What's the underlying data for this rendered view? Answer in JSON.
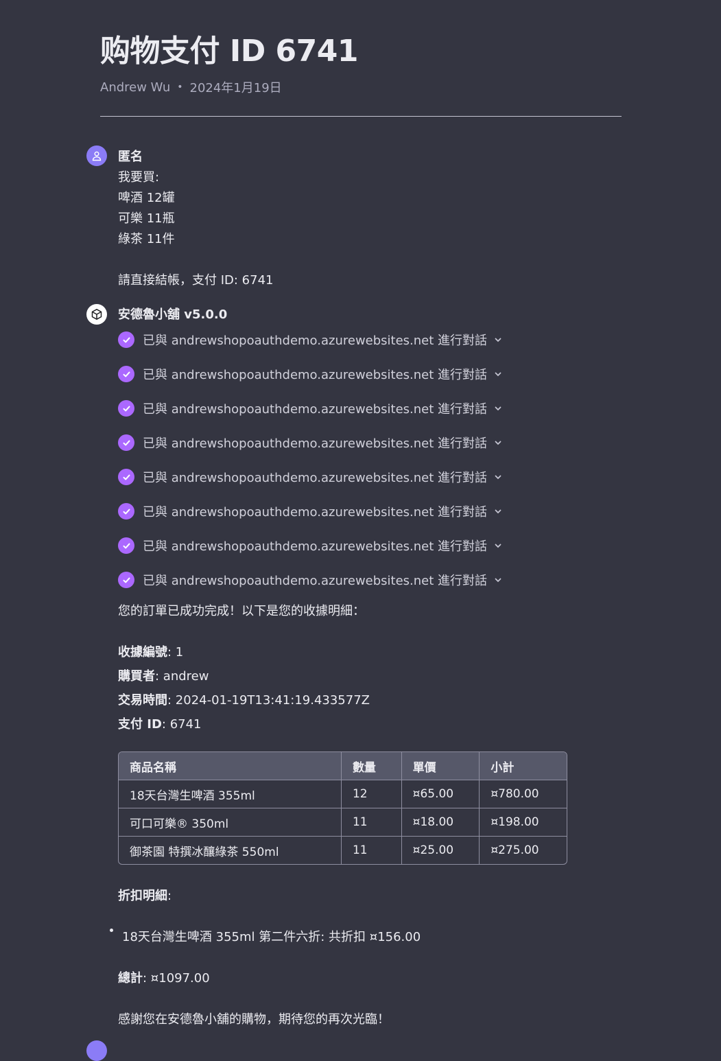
{
  "header": {
    "title": "购物支付 ID 6741",
    "author": "Andrew Wu",
    "separator": "•",
    "date": "2024年1月19日"
  },
  "user_message": {
    "sender": "匿名",
    "lines": [
      "我要買:",
      "啤酒 12罐",
      "可樂 11瓶",
      "綠茶 11件"
    ],
    "closing": "請直接結帳，支付 ID: 6741"
  },
  "assistant": {
    "name": "安德魯小舖 v5.0.0",
    "plugin_calls": [
      {
        "label": "已與 andrewshopoauthdemo.azurewebsites.net 進行對話"
      },
      {
        "label": "已與 andrewshopoauthdemo.azurewebsites.net 進行對話"
      },
      {
        "label": "已與 andrewshopoauthdemo.azurewebsites.net 進行對話"
      },
      {
        "label": "已與 andrewshopoauthdemo.azurewebsites.net 進行對話"
      },
      {
        "label": "已與 andrewshopoauthdemo.azurewebsites.net 進行對話"
      },
      {
        "label": "已與 andrewshopoauthdemo.azurewebsites.net 進行對話"
      },
      {
        "label": "已與 andrewshopoauthdemo.azurewebsites.net 進行對話"
      },
      {
        "label": "已與 andrewshopoauthdemo.azurewebsites.net 進行對話"
      }
    ],
    "intro": "您的訂單已成功完成！以下是您的收據明細：",
    "receipt": {
      "number_label": "收據編號",
      "number": ": 1",
      "buyer_label": "購買者",
      "buyer": ": andrew",
      "time_label": "交易時間",
      "time": ": 2024-01-19T13:41:19.433577Z",
      "payment_label": "支付 ID",
      "payment": ": 6741"
    },
    "table": {
      "headers": [
        "商品名稱",
        "數量",
        "單價",
        "小計"
      ],
      "rows": [
        [
          "18天台灣生啤酒 355ml",
          "12",
          "¤65.00",
          "¤780.00"
        ],
        [
          "可口可樂® 350ml",
          "11",
          "¤18.00",
          "¤198.00"
        ],
        [
          "御茶園 特撰冰釀綠茶 550ml",
          "11",
          "¤25.00",
          "¤275.00"
        ]
      ]
    },
    "discount_heading": "折扣明細",
    "discount_colon": ":",
    "discount_item": "18天台灣生啤酒 355ml 第二件六折: 共折扣 ¤156.00",
    "total_label": "總計",
    "total_value": ": ¤1097.00",
    "thanks": "感謝您在安德魯小舖的購物，期待您的再次光臨！"
  },
  "icons": {
    "user_avatar": "user-icon",
    "bot_avatar": "cube-icon",
    "check": "check-icon",
    "chevron": "chevron-down-icon"
  },
  "colors": {
    "background": "#343541",
    "accent_purple": "#ab68ff",
    "user_avatar": "#8b7cf6"
  }
}
